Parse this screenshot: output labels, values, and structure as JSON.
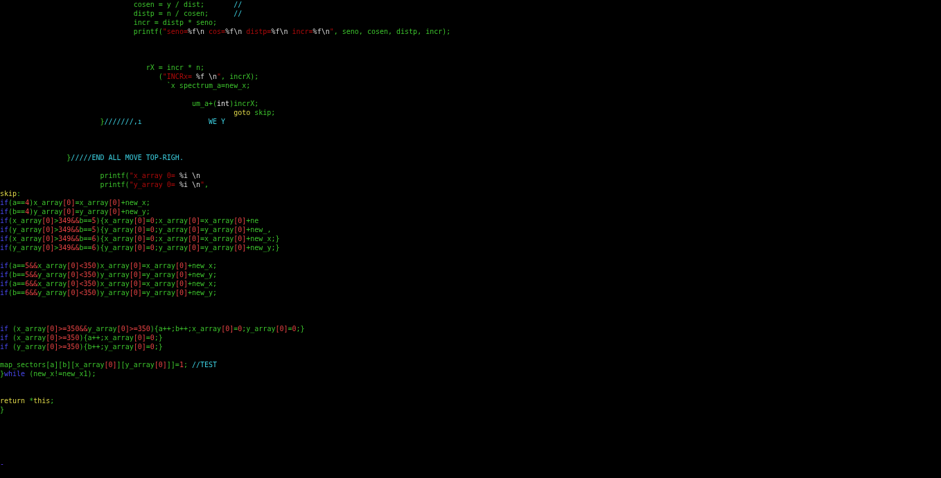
{
  "editor": {
    "lines": [
      {
        "groups": [
          {
            "segments": [
              {
                "kind": "code",
                "text": "cosen = y / dist;"
              }
            ]
          },
          {
            "segments": [
              {
                "kind": "comment",
                "text": "//"
              }
            ]
          }
        ]
      },
      {
        "groups": [
          {
            "segments": [
              {
                "kind": "code",
                "text": "distp = n / cosen;"
              }
            ]
          },
          {
            "segments": [
              {
                "kind": "comment",
                "text": "//"
              }
            ]
          }
        ]
      },
      {
        "groups": [
          {
            "segments": [
              {
                "kind": "code",
                "text": "incr = distp * seno;"
              }
            ]
          }
        ]
      },
      {
        "groups": [
          {
            "segments": [
              {
                "kind": "code",
                "text": "printf("
              },
              {
                "kind": "string",
                "text": "\"seno="
              },
              {
                "kind": "escape",
                "text": "%f\\n"
              },
              {
                "kind": "string",
                "text": " cos="
              },
              {
                "kind": "escape",
                "text": "%f\\n"
              },
              {
                "kind": "string",
                "text": " distp="
              },
              {
                "kind": "escape",
                "text": "%f\\n"
              },
              {
                "kind": "string",
                "text": " incr="
              },
              {
                "kind": "escape",
                "text": "%f\\n"
              },
              {
                "kind": "string",
                "text": "\""
              },
              {
                "kind": "code",
                "text": ", seno, cosen, distp, incr);"
              }
            ]
          }
        ]
      },
      {
        "groups": [
          {
            "segments": [
              {
                "kind": "code",
                "text": "rX = incr * n;"
              }
            ]
          }
        ]
      },
      {
        "groups": [
          {
            "segments": [
              {
                "kind": "code",
                "text": "("
              },
              {
                "kind": "string",
                "text": "\"INCRx= "
              },
              {
                "kind": "escape",
                "text": "%f \\n"
              },
              {
                "kind": "string",
                "text": "\""
              },
              {
                "kind": "code",
                "text": ", incrX);"
              }
            ]
          }
        ]
      },
      {
        "groups": [
          {
            "segments": [
              {
                "kind": "code",
                "text": "`x spectrum_a=new_x;"
              }
            ]
          }
        ]
      },
      {
        "groups": [
          {
            "segments": [
              {
                "kind": "code",
                "text": "um_a+("
              },
              {
                "kind": "type",
                "text": "int"
              },
              {
                "kind": "code",
                "text": ")incrX;"
              }
            ]
          }
        ]
      },
      {
        "groups": [
          {
            "segments": [
              {
                "kind": "label",
                "text": "goto"
              },
              {
                "kind": "code",
                "text": " skip;"
              }
            ]
          }
        ]
      },
      {
        "groups": [
          {
            "segments": [
              {
                "kind": "code",
                "text": "}"
              },
              {
                "kind": "comment",
                "text": "///////,ı"
              }
            ]
          },
          {
            "segments": [
              {
                "kind": "comment",
                "text": "WE Y"
              }
            ]
          }
        ]
      },
      {
        "groups": [
          {
            "segments": [
              {
                "kind": "code",
                "text": "}"
              },
              {
                "kind": "comment",
                "text": "/////END ALL MOVE TOP-RIGH."
              }
            ]
          }
        ]
      },
      {
        "groups": [
          {
            "segments": [
              {
                "kind": "code",
                "text": "printf("
              },
              {
                "kind": "string",
                "text": "\"x_array 0= "
              },
              {
                "kind": "escape",
                "text": "%i \\n"
              }
            ]
          }
        ]
      },
      {
        "groups": [
          {
            "segments": [
              {
                "kind": "code",
                "text": "printf("
              },
              {
                "kind": "string",
                "text": "\"y_array 0= "
              },
              {
                "kind": "escape",
                "text": "%i \\n"
              },
              {
                "kind": "string",
                "text": "\""
              },
              {
                "kind": "code",
                "text": ","
              }
            ]
          }
        ]
      },
      {
        "groups": [
          {
            "segments": [
              {
                "kind": "label",
                "text": "skip"
              },
              {
                "kind": "code",
                "text": ":"
              }
            ]
          }
        ]
      },
      {
        "groups": [
          {
            "segments": [
              {
                "kind": "keyword",
                "text": "if"
              },
              {
                "kind": "code",
                "text": "(a=="
              },
              {
                "kind": "number",
                "text": "4"
              },
              {
                "kind": "code",
                "text": ")x_array"
              },
              {
                "kind": "number",
                "text": "[0]"
              },
              {
                "kind": "code",
                "text": "=x_array"
              },
              {
                "kind": "number",
                "text": "[0]"
              },
              {
                "kind": "code",
                "text": "+new_x;"
              }
            ]
          }
        ]
      },
      {
        "groups": [
          {
            "segments": [
              {
                "kind": "keyword",
                "text": "if"
              },
              {
                "kind": "code",
                "text": "(b=="
              },
              {
                "kind": "number",
                "text": "4"
              },
              {
                "kind": "code",
                "text": ")y_array"
              },
              {
                "kind": "number",
                "text": "[0]"
              },
              {
                "kind": "code",
                "text": "=y_array"
              },
              {
                "kind": "number",
                "text": "[0]"
              },
              {
                "kind": "code",
                "text": "+new_y;"
              }
            ]
          }
        ]
      },
      {
        "groups": [
          {
            "segments": [
              {
                "kind": "keyword",
                "text": "if"
              },
              {
                "kind": "code",
                "text": "(x_array"
              },
              {
                "kind": "number",
                "text": "[0]"
              },
              {
                "kind": "code",
                "text": ">"
              },
              {
                "kind": "number",
                "text": "349&&"
              },
              {
                "kind": "code",
                "text": "b=="
              },
              {
                "kind": "number",
                "text": "5"
              },
              {
                "kind": "code",
                "text": "){x_array"
              },
              {
                "kind": "number",
                "text": "[0]"
              },
              {
                "kind": "code",
                "text": "="
              },
              {
                "kind": "number",
                "text": "0"
              },
              {
                "kind": "code",
                "text": ";x_array"
              },
              {
                "kind": "number",
                "text": "[0]"
              },
              {
                "kind": "code",
                "text": "=x_array"
              },
              {
                "kind": "number",
                "text": "[0]"
              },
              {
                "kind": "code",
                "text": "+ne"
              }
            ]
          }
        ]
      },
      {
        "groups": [
          {
            "segments": [
              {
                "kind": "keyword",
                "text": "if"
              },
              {
                "kind": "code",
                "text": "(y_array"
              },
              {
                "kind": "number",
                "text": "[0]"
              },
              {
                "kind": "code",
                "text": ">"
              },
              {
                "kind": "number",
                "text": "349&&"
              },
              {
                "kind": "code",
                "text": "b=="
              },
              {
                "kind": "number",
                "text": "5"
              },
              {
                "kind": "code",
                "text": "){y_array"
              },
              {
                "kind": "number",
                "text": "[0]"
              },
              {
                "kind": "code",
                "text": "="
              },
              {
                "kind": "number",
                "text": "0"
              },
              {
                "kind": "code",
                "text": ";y_array"
              },
              {
                "kind": "number",
                "text": "[0]"
              },
              {
                "kind": "code",
                "text": "=y_array"
              },
              {
                "kind": "number",
                "text": "[0]"
              },
              {
                "kind": "code",
                "text": "+new_,"
              }
            ]
          }
        ]
      },
      {
        "groups": [
          {
            "segments": [
              {
                "kind": "keyword",
                "text": "if"
              },
              {
                "kind": "code",
                "text": "(x_array"
              },
              {
                "kind": "number",
                "text": "[0]"
              },
              {
                "kind": "code",
                "text": ">"
              },
              {
                "kind": "number",
                "text": "349&&"
              },
              {
                "kind": "code",
                "text": "b=="
              },
              {
                "kind": "number",
                "text": "6"
              },
              {
                "kind": "code",
                "text": "){x_array"
              },
              {
                "kind": "number",
                "text": "[0]"
              },
              {
                "kind": "code",
                "text": "="
              },
              {
                "kind": "number",
                "text": "0"
              },
              {
                "kind": "code",
                "text": ";x_array"
              },
              {
                "kind": "number",
                "text": "[0]"
              },
              {
                "kind": "code",
                "text": "=x_array"
              },
              {
                "kind": "number",
                "text": "[0]"
              },
              {
                "kind": "code",
                "text": "+new_x;}"
              }
            ]
          }
        ]
      },
      {
        "groups": [
          {
            "segments": [
              {
                "kind": "keyword",
                "text": "if"
              },
              {
                "kind": "code",
                "text": "(y_array"
              },
              {
                "kind": "number",
                "text": "[0]"
              },
              {
                "kind": "code",
                "text": ">"
              },
              {
                "kind": "number",
                "text": "349&&"
              },
              {
                "kind": "code",
                "text": "b=="
              },
              {
                "kind": "number",
                "text": "6"
              },
              {
                "kind": "code",
                "text": "){y_array"
              },
              {
                "kind": "number",
                "text": "[0]"
              },
              {
                "kind": "code",
                "text": "="
              },
              {
                "kind": "number",
                "text": "0"
              },
              {
                "kind": "code",
                "text": ";y_array"
              },
              {
                "kind": "number",
                "text": "[0]"
              },
              {
                "kind": "code",
                "text": "=y_array"
              },
              {
                "kind": "number",
                "text": "[0]"
              },
              {
                "kind": "code",
                "text": "+new_y;}"
              }
            ]
          }
        ]
      },
      {
        "groups": [
          {
            "segments": [
              {
                "kind": "keyword",
                "text": "if"
              },
              {
                "kind": "code",
                "text": "(a=="
              },
              {
                "kind": "number",
                "text": "5&&"
              },
              {
                "kind": "code",
                "text": "x_array"
              },
              {
                "kind": "number",
                "text": "[0]<350"
              },
              {
                "kind": "code",
                "text": ")x_array"
              },
              {
                "kind": "number",
                "text": "[0]"
              },
              {
                "kind": "code",
                "text": "=x_array"
              },
              {
                "kind": "number",
                "text": "[0]"
              },
              {
                "kind": "code",
                "text": "+new_x;"
              }
            ]
          }
        ]
      },
      {
        "groups": [
          {
            "segments": [
              {
                "kind": "keyword",
                "text": "if"
              },
              {
                "kind": "code",
                "text": "(b=="
              },
              {
                "kind": "number",
                "text": "5&&"
              },
              {
                "kind": "code",
                "text": "y_array"
              },
              {
                "kind": "number",
                "text": "[0]<350"
              },
              {
                "kind": "code",
                "text": ")y_array"
              },
              {
                "kind": "number",
                "text": "[0]"
              },
              {
                "kind": "code",
                "text": "=y_array"
              },
              {
                "kind": "number",
                "text": "[0]"
              },
              {
                "kind": "code",
                "text": "+new_y;"
              }
            ]
          }
        ]
      },
      {
        "groups": [
          {
            "segments": [
              {
                "kind": "keyword",
                "text": "if"
              },
              {
                "kind": "code",
                "text": "(a=="
              },
              {
                "kind": "number",
                "text": "6&&"
              },
              {
                "kind": "code",
                "text": "x_array"
              },
              {
                "kind": "number",
                "text": "[0]<350"
              },
              {
                "kind": "code",
                "text": ")x_array"
              },
              {
                "kind": "number",
                "text": "[0]"
              },
              {
                "kind": "code",
                "text": "=x_array"
              },
              {
                "kind": "number",
                "text": "[0]"
              },
              {
                "kind": "code",
                "text": "+new_x;"
              }
            ]
          }
        ]
      },
      {
        "groups": [
          {
            "segments": [
              {
                "kind": "keyword",
                "text": "if"
              },
              {
                "kind": "code",
                "text": "(b=="
              },
              {
                "kind": "number",
                "text": "6&&"
              },
              {
                "kind": "code",
                "text": "y_array"
              },
              {
                "kind": "number",
                "text": "[0]<350"
              },
              {
                "kind": "code",
                "text": ")y_array"
              },
              {
                "kind": "number",
                "text": "[0]"
              },
              {
                "kind": "code",
                "text": "=y_array"
              },
              {
                "kind": "number",
                "text": "[0]"
              },
              {
                "kind": "code",
                "text": "+new_y;"
              }
            ]
          }
        ]
      },
      {
        "groups": [
          {
            "segments": [
              {
                "kind": "keyword",
                "text": "if"
              },
              {
                "kind": "code",
                "text": " (x_array"
              },
              {
                "kind": "number",
                "text": "[0]>=350&&"
              },
              {
                "kind": "code",
                "text": "y_array"
              },
              {
                "kind": "number",
                "text": "[0]>=350"
              },
              {
                "kind": "code",
                "text": "){a++;b++;x_array"
              },
              {
                "kind": "number",
                "text": "[0]"
              },
              {
                "kind": "code",
                "text": "="
              },
              {
                "kind": "number",
                "text": "0"
              },
              {
                "kind": "code",
                "text": ";y_array"
              },
              {
                "kind": "number",
                "text": "[0]"
              },
              {
                "kind": "code",
                "text": "="
              },
              {
                "kind": "number",
                "text": "0"
              },
              {
                "kind": "code",
                "text": ";}"
              }
            ]
          }
        ]
      },
      {
        "groups": [
          {
            "segments": [
              {
                "kind": "keyword",
                "text": "if"
              },
              {
                "kind": "code",
                "text": " (x_array"
              },
              {
                "kind": "number",
                "text": "[0]>=350"
              },
              {
                "kind": "code",
                "text": "){a++;x_array"
              },
              {
                "kind": "number",
                "text": "[0]"
              },
              {
                "kind": "code",
                "text": "="
              },
              {
                "kind": "number",
                "text": "0"
              },
              {
                "kind": "code",
                "text": ";}"
              }
            ]
          }
        ]
      },
      {
        "groups": [
          {
            "segments": [
              {
                "kind": "keyword",
                "text": "if"
              },
              {
                "kind": "code",
                "text": " (y_array"
              },
              {
                "kind": "number",
                "text": "[0]>=350"
              },
              {
                "kind": "code",
                "text": "){b++;y_array"
              },
              {
                "kind": "number",
                "text": "[0]"
              },
              {
                "kind": "code",
                "text": "="
              },
              {
                "kind": "number",
                "text": "0"
              },
              {
                "kind": "code",
                "text": ";}"
              }
            ]
          }
        ]
      },
      {
        "groups": [
          {
            "segments": [
              {
                "kind": "code",
                "text": "map_sectors[a][b][x_array"
              },
              {
                "kind": "number",
                "text": "[0]"
              },
              {
                "kind": "code",
                "text": "][y_array"
              },
              {
                "kind": "number",
                "text": "[0]"
              },
              {
                "kind": "code",
                "text": "]]="
              },
              {
                "kind": "number",
                "text": "1"
              },
              {
                "kind": "code",
                "text": ";"
              }
            ]
          },
          {
            "segments": [
              {
                "kind": "comment",
                "text": "//TEST"
              }
            ]
          }
        ]
      },
      {
        "groups": [
          {
            "segments": [
              {
                "kind": "code",
                "text": "}"
              },
              {
                "kind": "keyword",
                "text": "while"
              },
              {
                "kind": "code",
                "text": " (new_x!=new_x1);"
              }
            ]
          }
        ]
      },
      {
        "groups": [
          {
            "segments": [
              {
                "kind": "label",
                "text": "return"
              },
              {
                "kind": "code",
                "text": " *"
              },
              {
                "kind": "label",
                "text": "this"
              },
              {
                "kind": "code",
                "text": ";"
              }
            ]
          }
        ]
      },
      {
        "groups": [
          {
            "segments": [
              {
                "kind": "code",
                "text": "}"
              }
            ]
          }
        ]
      },
      {
        "groups": [
          {
            "segments": [
              {
                "kind": "marker",
                "text": "-"
              }
            ]
          }
        ]
      }
    ]
  }
}
